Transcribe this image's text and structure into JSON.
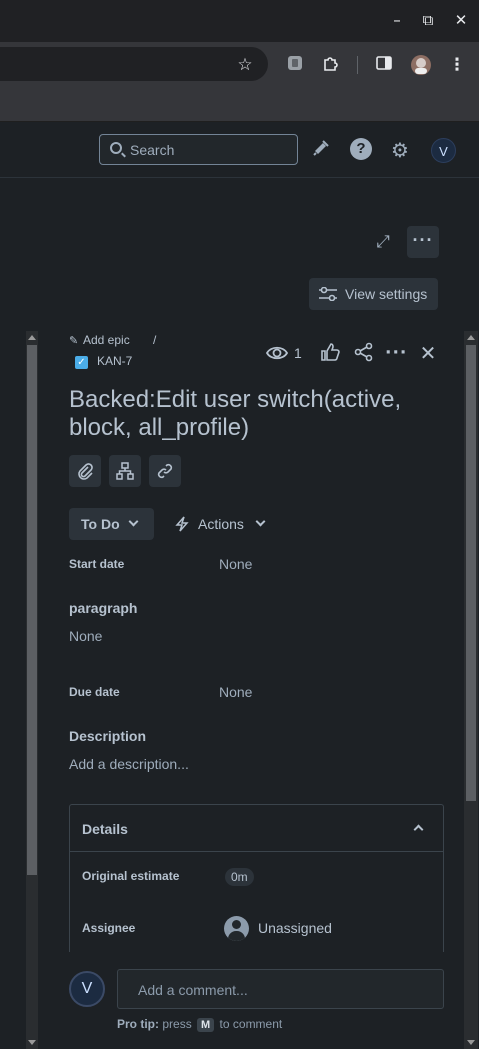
{
  "browser": {
    "window_controls": [
      "minimize",
      "restore",
      "close"
    ],
    "toolbar_icons": [
      "star-icon",
      "extension-icon",
      "puzzle-icon",
      "sidepanel-icon",
      "profile-icon",
      "menu-icon"
    ]
  },
  "header": {
    "search_placeholder": "Search",
    "avatar_initial": "V"
  },
  "controls": {
    "view_settings_label": "View settings"
  },
  "issue": {
    "add_epic_label": "Add epic",
    "breadcrumb_separator": "/",
    "key": "KAN-7",
    "watch_count": "1",
    "summary": "Backed:Edit user switch(active, block, all_profile)",
    "status_label": "To Do",
    "actions_label": "Actions",
    "fields": {
      "start_date_label": "Start date",
      "start_date_value": "None",
      "paragraph_label": "paragraph",
      "paragraph_value": "None",
      "due_date_label": "Due date",
      "due_date_value": "None",
      "description_label": "Description",
      "description_placeholder": "Add a description..."
    },
    "details": {
      "title": "Details",
      "original_estimate_label": "Original estimate",
      "original_estimate_value": "0m",
      "assignee_label": "Assignee",
      "assignee_value": "Unassigned"
    },
    "comment": {
      "avatar_initial": "V",
      "placeholder": "Add a comment...",
      "protip_prefix": "Pro tip:",
      "protip_press": "press",
      "protip_key": "M",
      "protip_suffix": "to comment"
    }
  },
  "colors": {
    "background": "#1d2125",
    "button_bg": "#2c333a",
    "text": "#b6c2cf",
    "checkbox_blue": "#4bade8"
  }
}
